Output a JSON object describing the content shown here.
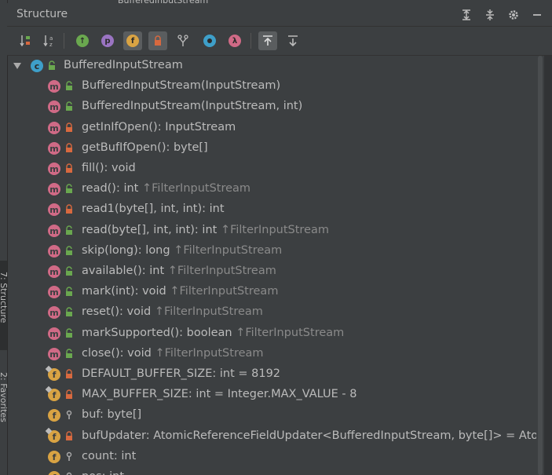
{
  "panel": {
    "title": "Structure",
    "top_fragment": "BufferedInputStream"
  },
  "side_tabs": {
    "structure": "7: Structure",
    "favorites": "2: Favorites"
  },
  "toolbar": {
    "tools": [
      {
        "name": "sort-by-visibility",
        "icon": "sort-visibility-icon"
      },
      {
        "name": "sort-alphabetically",
        "icon": "sort-alpha-icon"
      },
      {
        "name": "show-inherited",
        "icon": "inherited-icon"
      },
      {
        "name": "show-properties",
        "icon": "properties-icon"
      },
      {
        "name": "show-fields",
        "icon": "field-icon"
      },
      {
        "name": "show-non-public",
        "icon": "lock-icon"
      },
      {
        "name": "show-lambdas-anonymous",
        "icon": "fork-icon"
      },
      {
        "name": "show-anonymous",
        "icon": "anonymous-icon"
      },
      {
        "name": "show-lambdas",
        "icon": "lambda-icon"
      },
      {
        "name": "autoscroll-to-source",
        "icon": "autoscroll-to-icon"
      },
      {
        "name": "autoscroll-from-source",
        "icon": "autoscroll-from-icon"
      }
    ]
  },
  "tree": {
    "root": {
      "label": "BufferedInputStream",
      "kind": "c"
    },
    "items": [
      {
        "kind": "m",
        "vis": "public",
        "text": "BufferedInputStream(InputStream)",
        "inherited": ""
      },
      {
        "kind": "m",
        "vis": "public",
        "text": "BufferedInputStream(InputStream, int)",
        "inherited": ""
      },
      {
        "kind": "m",
        "vis": "private",
        "text": "getInIfOpen(): InputStream",
        "inherited": ""
      },
      {
        "kind": "m",
        "vis": "private",
        "text": "getBufIfOpen(): byte[]",
        "inherited": ""
      },
      {
        "kind": "m",
        "vis": "private",
        "text": "fill(): void",
        "inherited": ""
      },
      {
        "kind": "m",
        "vis": "public",
        "text": "read(): int ",
        "inherited": "↑FilterInputStream"
      },
      {
        "kind": "m",
        "vis": "private",
        "text": "read1(byte[], int, int): int",
        "inherited": ""
      },
      {
        "kind": "m",
        "vis": "public",
        "text": "read(byte[], int, int): int ",
        "inherited": "↑FilterInputStream"
      },
      {
        "kind": "m",
        "vis": "public",
        "text": "skip(long): long ",
        "inherited": "↑FilterInputStream"
      },
      {
        "kind": "m",
        "vis": "public",
        "text": "available(): int ",
        "inherited": "↑FilterInputStream"
      },
      {
        "kind": "m",
        "vis": "public",
        "text": "mark(int): void ",
        "inherited": "↑FilterInputStream"
      },
      {
        "kind": "m",
        "vis": "public",
        "text": "reset(): void ",
        "inherited": "↑FilterInputStream"
      },
      {
        "kind": "m",
        "vis": "public",
        "text": "markSupported(): boolean ",
        "inherited": "↑FilterInputStream"
      },
      {
        "kind": "m",
        "vis": "public",
        "text": "close(): void ",
        "inherited": "↑FilterInputStream"
      },
      {
        "kind": "f",
        "vis": "private",
        "text": "DEFAULT_BUFFER_SIZE: int = 8192",
        "inherited": "",
        "static": true
      },
      {
        "kind": "f",
        "vis": "private",
        "text": "MAX_BUFFER_SIZE: int = Integer.MAX_VALUE - 8",
        "inherited": "",
        "static": true
      },
      {
        "kind": "f",
        "vis": "package",
        "text": "buf: byte[]",
        "inherited": ""
      },
      {
        "kind": "f",
        "vis": "private",
        "text": "bufUpdater: AtomicReferenceFieldUpdater<BufferedInputStream, byte[]> = Ator",
        "inherited": "",
        "static": true
      },
      {
        "kind": "f",
        "vis": "package",
        "text": "count: int",
        "inherited": ""
      },
      {
        "kind": "f",
        "vis": "package",
        "text": "pos: int",
        "inherited": ""
      }
    ]
  },
  "colors": {
    "method": "#d06a86",
    "field": "#d9a343",
    "class": "#3e9fc9",
    "public": "#6aa84f",
    "private": "#d8693f",
    "package": "#aaaaaa"
  }
}
